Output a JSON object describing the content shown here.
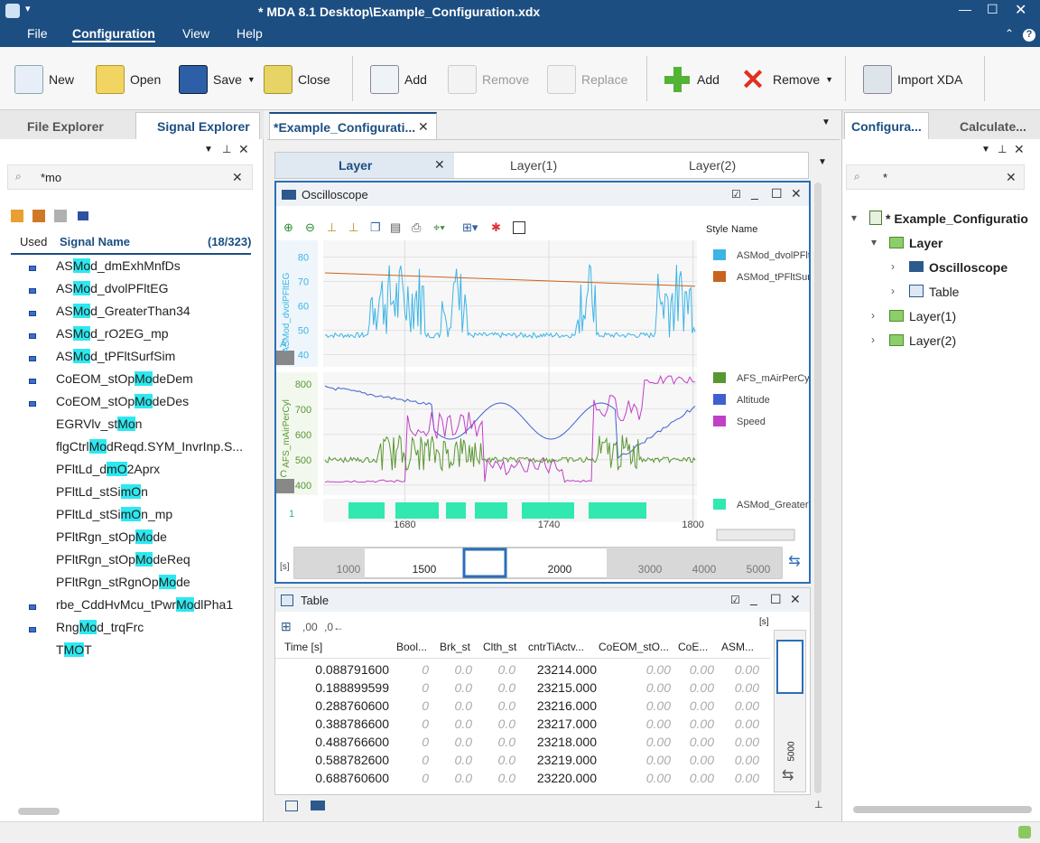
{
  "window": {
    "title": "* MDA 8.1  Desktop\\Example_Configuration.xdx"
  },
  "menu": [
    "File",
    "Configuration",
    "View",
    "Help"
  ],
  "ribbon": {
    "new": "New",
    "open": "Open",
    "save": "Save",
    "close": "Close",
    "add1": "Add",
    "remove1": "Remove",
    "replace": "Replace",
    "add2": "Add",
    "remove2": "Remove",
    "import": "Import XDA"
  },
  "left": {
    "tab_file": "File Explorer",
    "tab_signal": "Signal Explorer",
    "filter": "*mo",
    "col_used": "Used",
    "col_name": "Signal Name",
    "count": "(18/323)",
    "signals": [
      {
        "pre": "AS",
        "hl": "Mo",
        "post": "d_dmExhMnfDs",
        "used": true
      },
      {
        "pre": "AS",
        "hl": "Mo",
        "post": "d_dvolPFltEG",
        "used": true
      },
      {
        "pre": "AS",
        "hl": "Mo",
        "post": "d_GreaterThan34",
        "used": true
      },
      {
        "pre": "AS",
        "hl": "Mo",
        "post": "d_rO2EG_mp",
        "used": true
      },
      {
        "pre": "AS",
        "hl": "Mo",
        "post": "d_tPFltSurfSim",
        "used": true
      },
      {
        "pre": "CoEOM_stOp",
        "hl": "Mo",
        "post": "deDem",
        "used": true
      },
      {
        "pre": "CoEOM_stOp",
        "hl": "Mo",
        "post": "deDes",
        "used": true
      },
      {
        "pre": "EGRVlv_st",
        "hl": "Mo",
        "post": "n",
        "used": false
      },
      {
        "pre": "flgCtrl",
        "hl": "Mo",
        "post": "dReqd.SYM_InvrInp.S...",
        "used": false
      },
      {
        "pre": "PFltLd_d",
        "hl": "mO",
        "post": "2Aprx",
        "used": false
      },
      {
        "pre": "PFltLd_stSi",
        "hl": "mO",
        "post": "n",
        "used": false
      },
      {
        "pre": "PFltLd_stSi",
        "hl": "mO",
        "post": "n_mp",
        "used": false
      },
      {
        "pre": "PFltRgn_stOp",
        "hl": "Mo",
        "post": "de",
        "used": false
      },
      {
        "pre": "PFltRgn_stOp",
        "hl": "Mo",
        "post": "deReq",
        "used": false
      },
      {
        "pre": "PFltRgn_stRgnOp",
        "hl": "Mo",
        "post": "de",
        "used": false
      },
      {
        "pre": "rbe_CddHvMcu_tPwr",
        "hl": "Mo",
        "post": "dlPha1",
        "used": true
      },
      {
        "pre": "Rng",
        "hl": "Mo",
        "post": "d_trqFrc",
        "used": true
      },
      {
        "pre": "T",
        "hl": "MO",
        "post": "T",
        "used": false
      }
    ]
  },
  "doc": {
    "tab": "*Example_Configurati...",
    "layers": [
      "Layer",
      "Layer(1)",
      "Layer(2)"
    ]
  },
  "osc": {
    "title": "Oscilloscope",
    "style": "Style",
    "name": "Name",
    "legend1": [
      "ASMod_dvolPFlt",
      "ASMod_tPFltSur"
    ],
    "legend2": [
      "AFS_mAirPerCyl",
      "Altitude",
      "Speed"
    ],
    "legend3": [
      "ASMod_GreaterT"
    ],
    "axis1": "ASMod_dvolPFltEG",
    "axis2": "AFS_mAirPerCyl",
    "y1": [
      "80",
      "70",
      "60",
      "50",
      "40"
    ],
    "y2": [
      "800",
      "700",
      "600",
      "500",
      "400"
    ],
    "y3": "1",
    "x": [
      "1680",
      "1740",
      "1800"
    ],
    "unit": "[s]",
    "overview": [
      "1000",
      "1500",
      "2000",
      "3000",
      "4000",
      "5000"
    ],
    "chan_a": "A",
    "chan_c": "C"
  },
  "table": {
    "title": "Table",
    "headers": [
      "Time [s]",
      "Bool...",
      "Brk_st",
      "Clth_st",
      "cntrTiActv...",
      "CoEOM_stO...",
      "CoE...",
      "ASM..."
    ],
    "rows": [
      [
        "0.088791600",
        "0",
        "0.0",
        "0.0",
        "23214.000",
        "0.00",
        "0.00",
        "0.00"
      ],
      [
        "0.188899599",
        "0",
        "0.0",
        "0.0",
        "23215.000",
        "0.00",
        "0.00",
        "0.00"
      ],
      [
        "0.288760600",
        "0",
        "0.0",
        "0.0",
        "23216.000",
        "0.00",
        "0.00",
        "0.00"
      ],
      [
        "0.388786600",
        "0",
        "0.0",
        "0.0",
        "23217.000",
        "0.00",
        "0.00",
        "0.00"
      ],
      [
        "0.488766600",
        "0",
        "0.0",
        "0.0",
        "23218.000",
        "0.00",
        "0.00",
        "0.00"
      ],
      [
        "0.588782600",
        "0",
        "0.0",
        "0.0",
        "23219.000",
        "0.00",
        "0.00",
        "0.00"
      ],
      [
        "0.688760600",
        "0",
        "0.0",
        "0.0",
        "23220.000",
        "0.00",
        "0.00",
        "0.00"
      ]
    ],
    "scroll_label": "5000",
    "unit": "[s]"
  },
  "right": {
    "tab_conf": "Configura...",
    "tab_calc": "Calculate...",
    "filter": "*",
    "tree": {
      "root": "* Example_Configuratio",
      "layer": "Layer",
      "osc": "Oscilloscope",
      "table": "Table",
      "layer1": "Layer(1)",
      "layer2": "Layer(2)"
    }
  },
  "colors": {
    "accent": "#1c4e82",
    "highlight": "#2ee8f0",
    "ch1": "#3cb4e6",
    "ch2": "#c8641e",
    "ch3": "#5a9632",
    "ch4": "#4060d0",
    "ch5": "#c040c8",
    "ch6": "#30e8b0"
  }
}
